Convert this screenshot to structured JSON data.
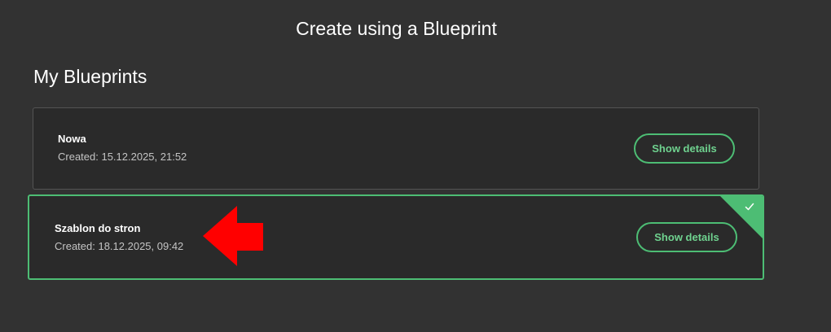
{
  "header": {
    "title": "Create using a Blueprint"
  },
  "section": {
    "title": "My Blueprints"
  },
  "blueprints": [
    {
      "name": "Nowa",
      "created": "Created: 15.12.2025, 21:52",
      "details_label": "Show details",
      "selected": false
    },
    {
      "name": "Szablon do stron",
      "created": "Created: 18.12.2025, 09:42",
      "details_label": "Show details",
      "selected": true
    }
  ],
  "colors": {
    "background": "#323232",
    "card": "#2a2a2a",
    "accent": "#4dbd74",
    "annotation_arrow": "#ff0000"
  },
  "icons": {
    "selected_check": "check-icon",
    "annotation": "arrow-left-icon"
  }
}
